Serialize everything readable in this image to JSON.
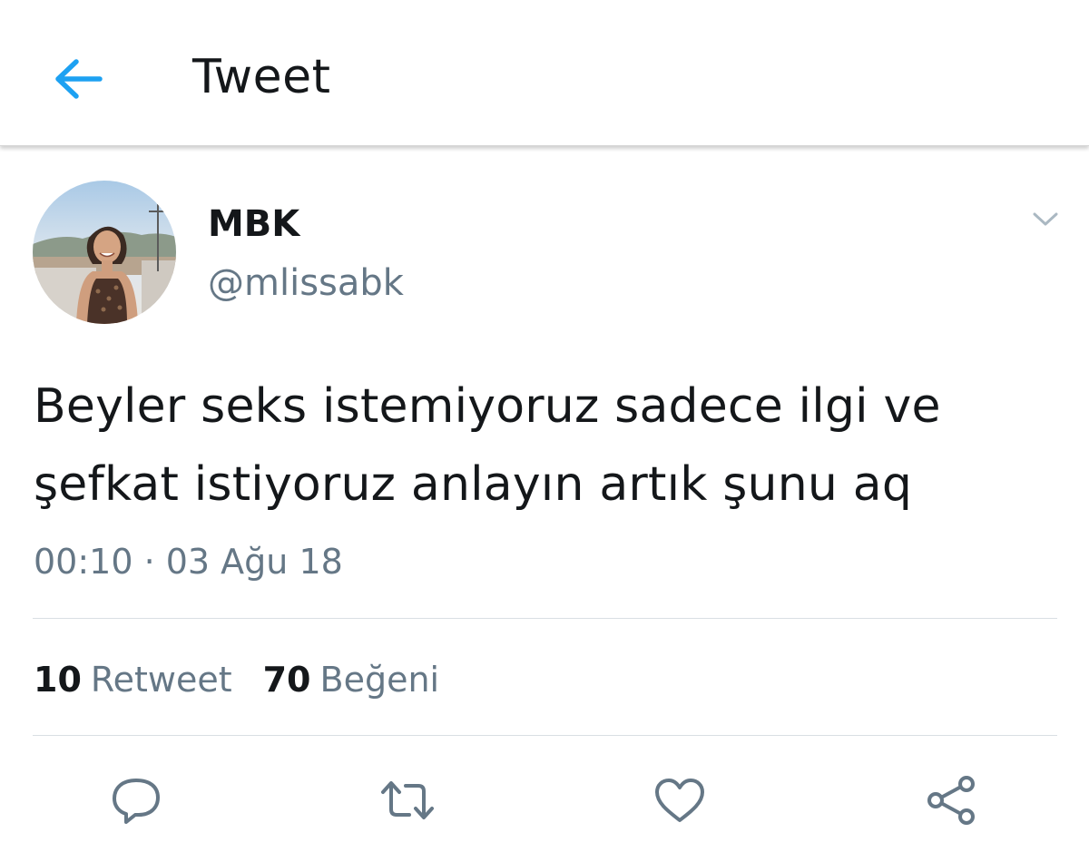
{
  "header": {
    "title": "Tweet",
    "back_icon": "arrow-left-icon"
  },
  "tweet": {
    "author": {
      "display_name": "MBK",
      "handle": "@mlissabk"
    },
    "text": "Beyler seks istemiyoruz sadece ilgi ve şefkat istiyoruz anlayın artık şunu aq",
    "timestamp": "00:10 · 03 Ağu 18",
    "stats": {
      "retweets_count": "10",
      "retweets_label": "Retweet",
      "likes_count": "70",
      "likes_label": "Beğeni"
    },
    "actions": [
      "reply-icon",
      "retweet-icon",
      "like-icon",
      "share-icon"
    ]
  },
  "colors": {
    "accent": "#1da1f2",
    "text_primary": "#14171a",
    "text_secondary": "#657786",
    "divider": "#d9dfe3"
  }
}
